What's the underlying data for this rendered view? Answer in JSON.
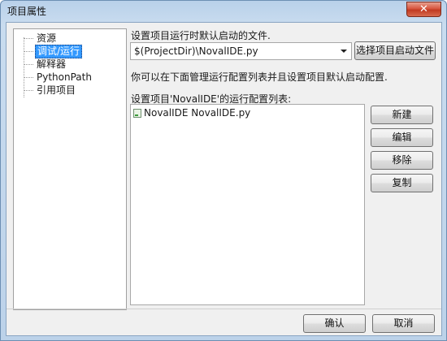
{
  "window": {
    "title": "项目属性",
    "close_label": "✕"
  },
  "tree": {
    "items": [
      {
        "label": "资源",
        "selected": false
      },
      {
        "label": "调试/运行",
        "selected": true
      },
      {
        "label": "解释器",
        "selected": false
      },
      {
        "label": "PythonPath",
        "selected": false
      },
      {
        "label": "引用项目",
        "selected": false
      }
    ]
  },
  "startup": {
    "label": "设置项目运行时默认启动的文件.",
    "value": "$(ProjectDir)\\NovalIDE.py",
    "select_button": "选择项目启动文件"
  },
  "hint": "你可以在下面管理运行配置列表并且设置项目默认启动配置.",
  "configs": {
    "label": "设置项目'NovalIDE'的运行配置列表:",
    "items": [
      "NovalIDE NovalIDE.py"
    ],
    "buttons": {
      "new": "新建",
      "edit": "编辑",
      "remove": "移除",
      "copy": "复制"
    }
  },
  "footer": {
    "ok": "确认",
    "cancel": "取消"
  }
}
